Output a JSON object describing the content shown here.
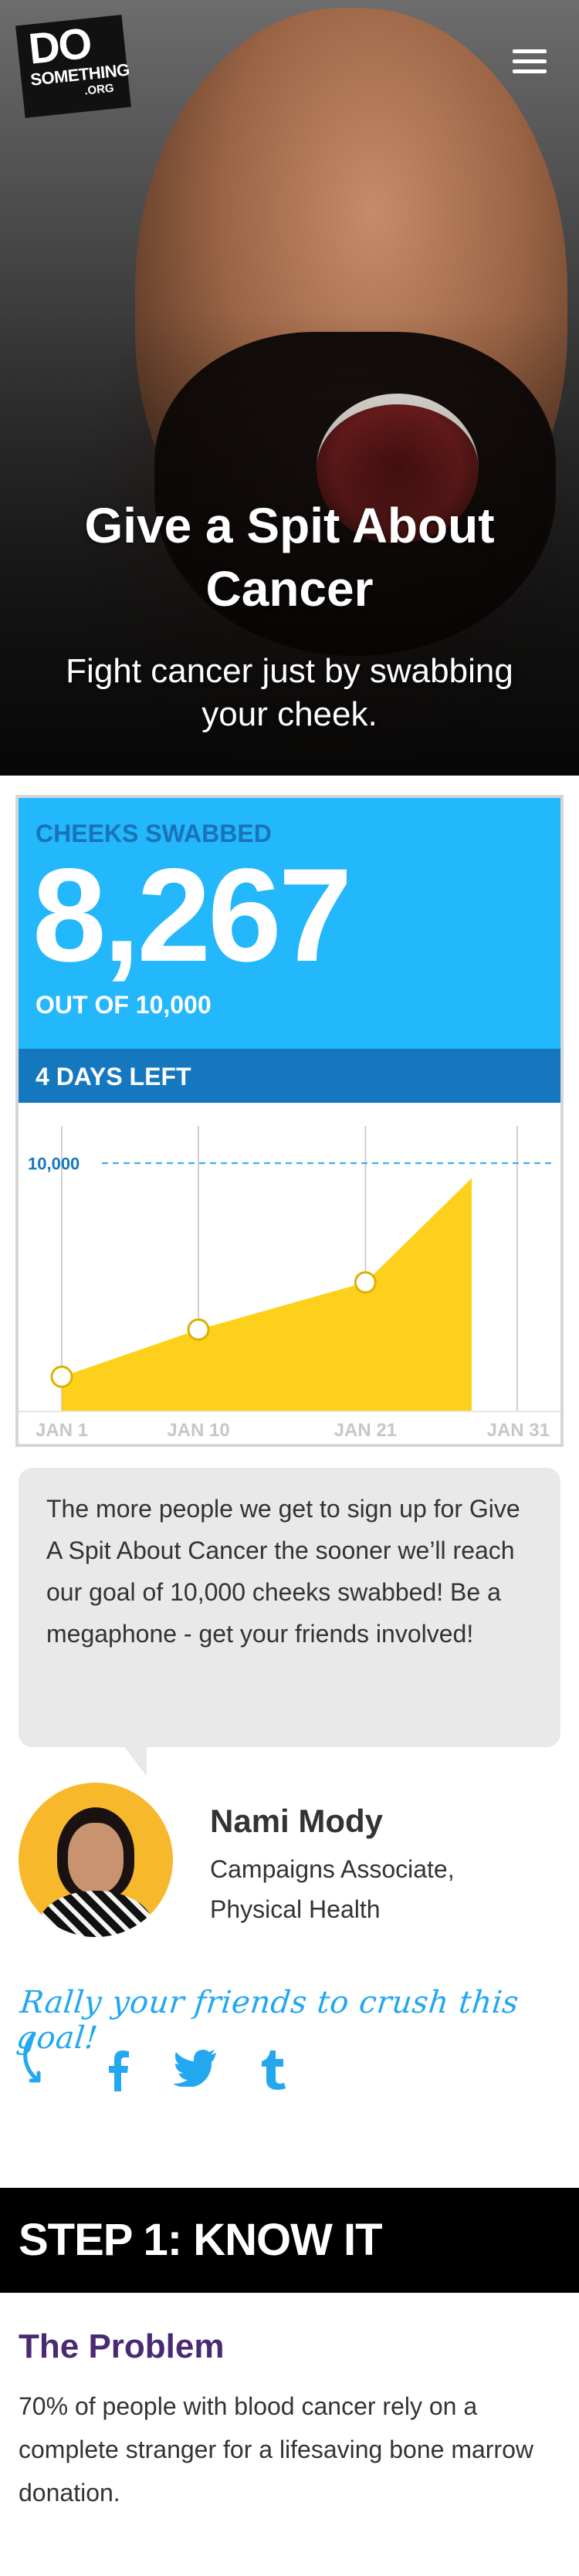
{
  "header": {
    "logo": {
      "line1": "DO",
      "line2": "SOMETHING",
      "line3": ".ORG"
    },
    "menu_icon": "hamburger-menu-icon"
  },
  "hero": {
    "title": "Give a Spit About Cancer",
    "subtitle": "Fight cancer just by swabbing your cheek."
  },
  "progress": {
    "label": "CHEEKS SWABBED",
    "count": "8,267",
    "goal_text": "OUT OF 10,000",
    "days_left": "4 DAYS LEFT",
    "colors": {
      "top": "#23b7fb",
      "bar": "#1578be",
      "label": "#1a73b8",
      "fill": "#fdd11b"
    }
  },
  "chart_data": {
    "type": "area",
    "title": "",
    "xlabel": "",
    "ylabel": "",
    "goal": {
      "value": 10000,
      "label": "10,000"
    },
    "x_ticks": [
      "JAN 1",
      "JAN 10",
      "JAN 21",
      "JAN 31"
    ],
    "x_range": [
      1,
      31
    ],
    "ylim": [
      0,
      11500
    ],
    "points": [
      {
        "x": 1,
        "y": 1400
      },
      {
        "x": 10,
        "y": 3300
      },
      {
        "x": 21,
        "y": 5200
      },
      {
        "x": 28,
        "y": 9400
      }
    ],
    "markers": [
      1,
      10,
      21
    ],
    "grid": "vertical"
  },
  "quote": {
    "text": "The more people we get to sign up for Give A Spit About Cancer the sooner we’ll reach our goal of 10,000 cheeks swabbed! Be a megaphone - get your friends involved!"
  },
  "staff": {
    "name": "Nami Mody",
    "title": "Campaigns Associate, Physical Health"
  },
  "share": {
    "prompt": "Rally your friends to crush this goal!",
    "icons": [
      "facebook-icon",
      "twitter-icon",
      "tumblr-icon"
    ]
  },
  "step1": {
    "title": "STEP 1: KNOW IT",
    "problem_heading": "The Problem",
    "problem_text": "70% of people with blood cancer rely on a complete stranger for a lifesaving bone marrow donation."
  }
}
